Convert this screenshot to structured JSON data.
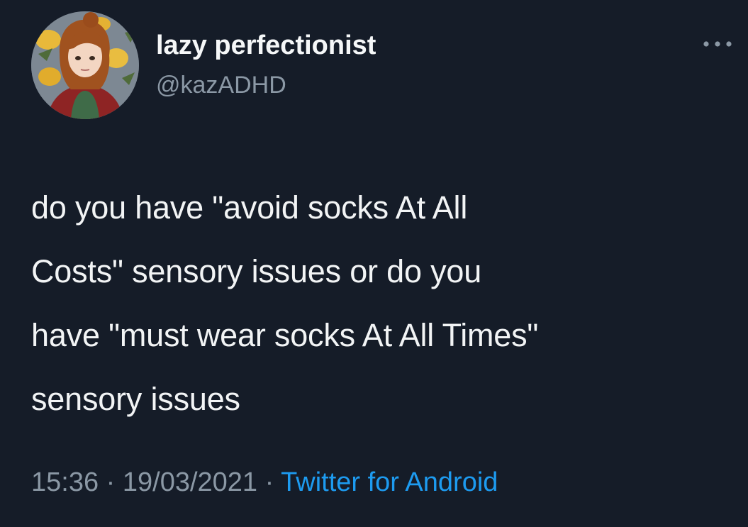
{
  "tweet": {
    "author": {
      "display_name": "lazy perfectionist",
      "handle": "@kazADHD",
      "avatar_icon": "profile-avatar"
    },
    "more_icon": "more-options-icon",
    "text": "do you have \"avoid socks At All\nCosts\" sensory issues or do you\nhave \"must wear socks At All Times\"\nsensory issues",
    "time": "15:36",
    "separator": "·",
    "date": "19/03/2021",
    "source": "Twitter for Android"
  },
  "colors": {
    "background": "#151c28",
    "text": "#f2f4f5",
    "secondary": "#8b98a5",
    "link": "#1d9bf0"
  }
}
